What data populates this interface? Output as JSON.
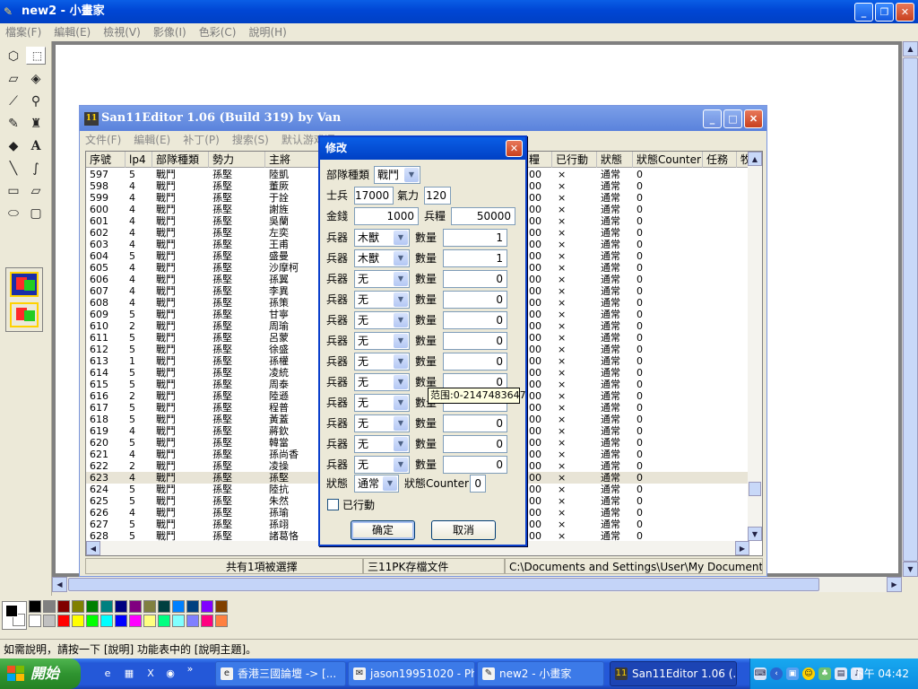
{
  "paint": {
    "title": "new2 - 小畫家",
    "menu": [
      "檔案(F)",
      "編輯(E)",
      "檢視(V)",
      "影像(I)",
      "色彩(C)",
      "說明(H)"
    ],
    "status": "如需說明，請按一下 [說明] 功能表中的 [說明主題]。",
    "palette_top": [
      "#000000",
      "#808080",
      "#800000",
      "#808000",
      "#008000",
      "#008080",
      "#000080",
      "#800080",
      "#808040",
      "#004040",
      "#0080ff",
      "#004080",
      "#8000ff",
      "#804000"
    ],
    "palette_bottom": [
      "#ffffff",
      "#c0c0c0",
      "#ff0000",
      "#ffff00",
      "#00ff00",
      "#00ffff",
      "#0000ff",
      "#ff00ff",
      "#ffff80",
      "#00ff80",
      "#80ffff",
      "#8080ff",
      "#ff0080",
      "#ff8040"
    ]
  },
  "editor": {
    "title": "San11Editor 1.06 (Build 319) by Van",
    "icon_text": "11",
    "menu": [
      "文件(F)",
      "編輯(E)",
      "补丁(P)",
      "搜索(S)",
      "默认游戏语"
    ],
    "columns": [
      "序號",
      "lp4",
      "部隊種類",
      "勢力",
      "主將",
      "糧",
      "已行動",
      "狀態",
      "狀態Counter",
      "任務",
      "牧"
    ],
    "rows": [
      [
        "597",
        "5",
        "戰鬥",
        "孫堅",
        "陸凱",
        "00",
        "×",
        "通常",
        "0"
      ],
      [
        "598",
        "4",
        "戰鬥",
        "孫堅",
        "董厥",
        "00",
        "×",
        "通常",
        "0"
      ],
      [
        "599",
        "4",
        "戰鬥",
        "孫堅",
        "于詮",
        "00",
        "×",
        "通常",
        "0"
      ],
      [
        "600",
        "4",
        "戰鬥",
        "孫堅",
        "謝旌",
        "00",
        "×",
        "通常",
        "0"
      ],
      [
        "601",
        "4",
        "戰鬥",
        "孫堅",
        "吳蘭",
        "00",
        "×",
        "通常",
        "0"
      ],
      [
        "602",
        "4",
        "戰鬥",
        "孫堅",
        "左奕",
        "00",
        "×",
        "通常",
        "0"
      ],
      [
        "603",
        "4",
        "戰鬥",
        "孫堅",
        "王甫",
        "00",
        "×",
        "通常",
        "0"
      ],
      [
        "604",
        "5",
        "戰鬥",
        "孫堅",
        "盛曼",
        "00",
        "×",
        "通常",
        "0"
      ],
      [
        "605",
        "4",
        "戰鬥",
        "孫堅",
        "沙摩柯",
        "00",
        "×",
        "通常",
        "0"
      ],
      [
        "606",
        "4",
        "戰鬥",
        "孫堅",
        "孫翼",
        "00",
        "×",
        "通常",
        "0"
      ],
      [
        "607",
        "4",
        "戰鬥",
        "孫堅",
        "李異",
        "00",
        "×",
        "通常",
        "0"
      ],
      [
        "608",
        "4",
        "戰鬥",
        "孫堅",
        "孫策",
        "00",
        "×",
        "通常",
        "0"
      ],
      [
        "609",
        "5",
        "戰鬥",
        "孫堅",
        "甘寧",
        "00",
        "×",
        "通常",
        "0"
      ],
      [
        "610",
        "2",
        "戰鬥",
        "孫堅",
        "周瑜",
        "00",
        "×",
        "通常",
        "0"
      ],
      [
        "611",
        "5",
        "戰鬥",
        "孫堅",
        "呂蒙",
        "00",
        "×",
        "通常",
        "0"
      ],
      [
        "612",
        "5",
        "戰鬥",
        "孫堅",
        "徐盛",
        "00",
        "×",
        "通常",
        "0"
      ],
      [
        "613",
        "1",
        "戰鬥",
        "孫堅",
        "孫權",
        "00",
        "×",
        "通常",
        "0"
      ],
      [
        "614",
        "5",
        "戰鬥",
        "孫堅",
        "凌統",
        "00",
        "×",
        "通常",
        "0"
      ],
      [
        "615",
        "5",
        "戰鬥",
        "孫堅",
        "周泰",
        "00",
        "×",
        "通常",
        "0"
      ],
      [
        "616",
        "2",
        "戰鬥",
        "孫堅",
        "陸遜",
        "00",
        "×",
        "通常",
        "0"
      ],
      [
        "617",
        "5",
        "戰鬥",
        "孫堅",
        "程普",
        "00",
        "×",
        "通常",
        "0"
      ],
      [
        "618",
        "5",
        "戰鬥",
        "孫堅",
        "黃蓋",
        "00",
        "×",
        "通常",
        "0"
      ],
      [
        "619",
        "4",
        "戰鬥",
        "孫堅",
        "蔣欽",
        "00",
        "×",
        "通常",
        "0"
      ],
      [
        "620",
        "5",
        "戰鬥",
        "孫堅",
        "韓當",
        "00",
        "×",
        "通常",
        "0"
      ],
      [
        "621",
        "4",
        "戰鬥",
        "孫堅",
        "孫尚香",
        "00",
        "×",
        "通常",
        "0"
      ],
      [
        "622",
        "2",
        "戰鬥",
        "孫堅",
        "凌操",
        "00",
        "×",
        "通常",
        "0"
      ],
      [
        "623",
        "4",
        "戰鬥",
        "孫堅",
        "孫堅",
        "00",
        "×",
        "通常",
        "0"
      ],
      [
        "624",
        "5",
        "戰鬥",
        "孫堅",
        "陸抗",
        "00",
        "×",
        "通常",
        "0"
      ],
      [
        "625",
        "5",
        "戰鬥",
        "孫堅",
        "朱然",
        "00",
        "×",
        "通常",
        "0"
      ],
      [
        "626",
        "4",
        "戰鬥",
        "孫堅",
        "孫瑜",
        "00",
        "×",
        "通常",
        "0"
      ],
      [
        "627",
        "5",
        "戰鬥",
        "孫堅",
        "孫翊",
        "00",
        "×",
        "通常",
        "0"
      ],
      [
        "628",
        "5",
        "戰鬥",
        "孫堅",
        "諸葛恪",
        "00",
        "×",
        "通常",
        "0"
      ]
    ],
    "status": [
      "共有1項被選擇",
      "三11PK存檔文件",
      "C:\\Documents and Settings\\User\\My Documents\\Koei\\San"
    ]
  },
  "dialog": {
    "title": "修改",
    "unit_type_label": "部隊種類",
    "unit_type_value": "戰鬥",
    "soldiers_label": "士兵",
    "soldiers_value": "17000",
    "morale_label": "氣力",
    "morale_value": "120",
    "gold_label": "金錢",
    "gold_value": "1000",
    "food_label": "兵糧",
    "food_value": "50000",
    "weapon_label": "兵器",
    "qty_label": "數量",
    "weapons": [
      {
        "name": "木獸",
        "qty": "1"
      },
      {
        "name": "木獸",
        "qty": "1"
      },
      {
        "name": "无",
        "qty": "0"
      },
      {
        "name": "无",
        "qty": "0"
      },
      {
        "name": "无",
        "qty": "0"
      },
      {
        "name": "无",
        "qty": "0"
      },
      {
        "name": "无",
        "qty": "0"
      },
      {
        "name": "无",
        "qty": "0"
      },
      {
        "name": "无",
        "qty": ""
      },
      {
        "name": "无",
        "qty": "0"
      },
      {
        "name": "无",
        "qty": "0"
      },
      {
        "name": "无",
        "qty": "0"
      }
    ],
    "state_label": "狀態",
    "state_value": "通常",
    "state_counter_label": "狀態Counter",
    "state_counter_value": "0",
    "acted_label": "已行動",
    "ok_label": "确定",
    "cancel_label": "取消",
    "tooltip": "范围:0-2147483647"
  },
  "taskbar": {
    "start_label": "開始",
    "tasks": [
      "香港三國論壇 -> [...",
      "jason19951020 - Ph...",
      "new2 - 小畫家",
      "San11Editor 1.06 (..."
    ],
    "clock": "下午 04:42"
  }
}
